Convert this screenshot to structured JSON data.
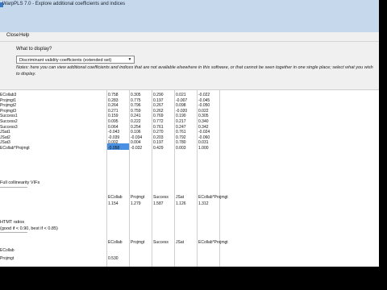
{
  "window": {
    "title": "WarpPLS 7.0 - Explore additional coefficients and indices"
  },
  "menu": {
    "items": [
      "Close",
      "Help"
    ]
  },
  "panel": {
    "prompt": "What to display?",
    "select_value": "Discriminant validity coefficients (extended set)",
    "notes": "Notes: here you can view additional coefficients and indices that are not available elsewhere in this software, or that cannot be seen together in one single place; select what you wish to display."
  },
  "discriminant_table": {
    "rows": [
      {
        "label": "ECollab3",
        "values": [
          "0.758",
          "0.305",
          "0.290",
          "0.021",
          "-0.022"
        ]
      },
      {
        "label": "Projmgt1",
        "values": [
          "0.283",
          "0.775",
          "0.197",
          "-0.007",
          "-0.045"
        ]
      },
      {
        "label": "Projmgt2",
        "values": [
          "0.264",
          "0.796",
          "0.267",
          "0.098",
          "-0.050"
        ]
      },
      {
        "label": "Projmgt3",
        "values": [
          "0.271",
          "0.759",
          "0.262",
          "-0.020",
          "0.022"
        ]
      },
      {
        "label": "Success1",
        "values": [
          "0.159",
          "0.241",
          "0.769",
          "0.190",
          "0.305"
        ]
      },
      {
        "label": "Success2",
        "values": [
          "0.095",
          "0.222",
          "0.772",
          "0.217",
          "0.340"
        ]
      },
      {
        "label": "Success3",
        "values": [
          "0.064",
          "0.254",
          "0.761",
          "0.247",
          "0.342"
        ]
      },
      {
        "label": "JSat1",
        "values": [
          "-0.043",
          "0.106",
          "0.270",
          "0.761",
          "-0.024"
        ]
      },
      {
        "label": "JSat2",
        "values": [
          "-0.039",
          "-0.034",
          "0.203",
          "0.792",
          "-0.060"
        ]
      },
      {
        "label": "JSat3",
        "values": [
          "0.002",
          "0.004",
          "0.197",
          "0.780",
          "0.031"
        ]
      },
      {
        "label": "ECollab*Projmgt",
        "values": [
          "-0.058",
          "-0.032",
          "0.429",
          "0.003",
          "1.000"
        ]
      }
    ]
  },
  "vifs": {
    "title": "Full collinearity VIFs",
    "headers": [
      "ECollab",
      "Projmgt",
      "Success",
      "JSat",
      "ECollab*Projmgt"
    ],
    "values": [
      "1.154",
      "1.279",
      "1.587",
      "1.126",
      "1.312"
    ]
  },
  "htmt": {
    "title": "HTMT ratios",
    "subtitle": "(good if < 0.90, best if < 0.85)",
    "headers": [
      "ECollab",
      "Projmgt",
      "Success",
      "JSat",
      "ECollab*Projmgt"
    ],
    "rows": [
      {
        "label": "ECollab",
        "values": []
      },
      {
        "label": "Projmgt",
        "values": [
          "0.530"
        ]
      }
    ]
  }
}
